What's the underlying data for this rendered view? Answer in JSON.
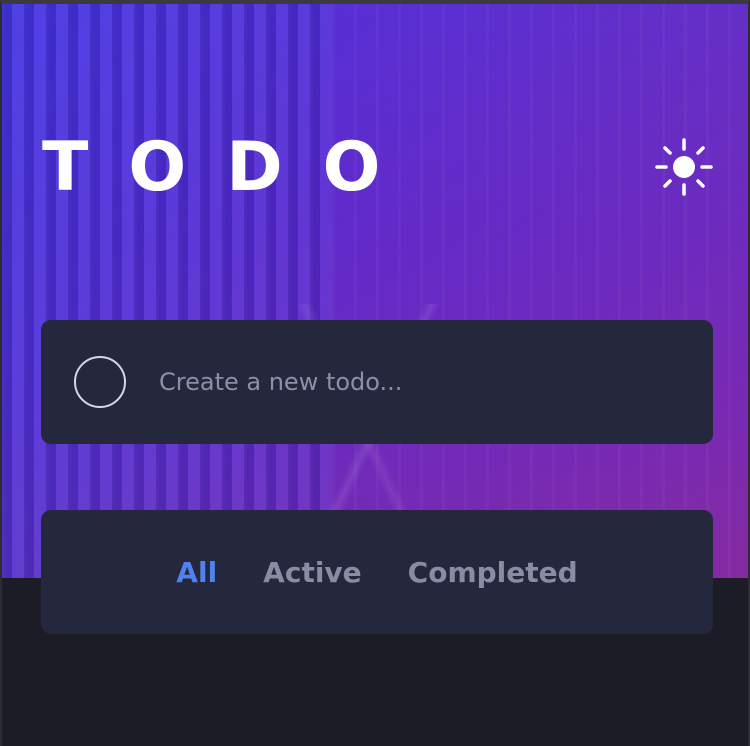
{
  "header": {
    "title": "TODO",
    "theme_icon": "sun-icon"
  },
  "new_todo": {
    "placeholder": "Create a new todo...",
    "value": ""
  },
  "filters": {
    "items": [
      "All",
      "Active",
      "Completed"
    ],
    "selected": "All"
  },
  "colors": {
    "card_background": "#25273c",
    "page_background": "#1b1c25",
    "active_filter": "#4f82ee",
    "inactive_filter": "#8a8ca3",
    "title": "#ffffff"
  }
}
